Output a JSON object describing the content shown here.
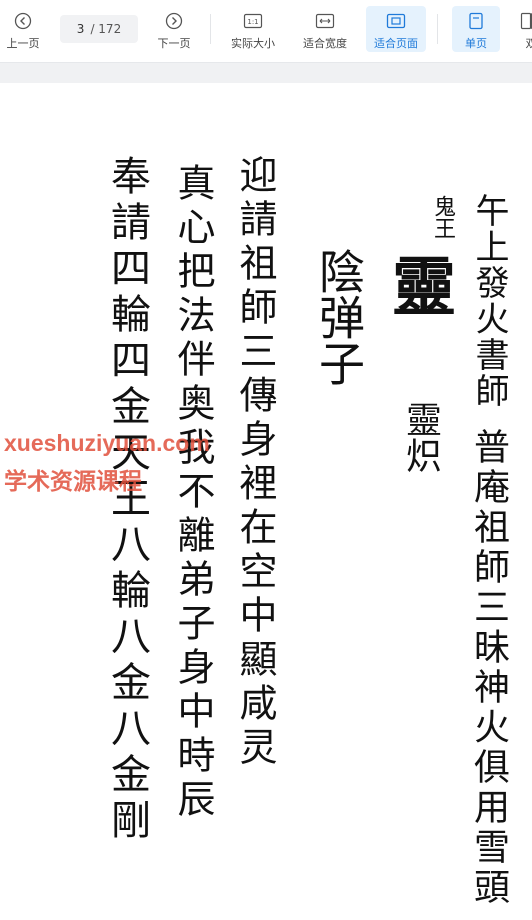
{
  "toolbar": {
    "prev_label": "上一页",
    "current_page": "3",
    "total_pages": "/ 172",
    "next_label": "下一页",
    "actual_size_label": "实际大小",
    "fit_width_label": "适合宽度",
    "fit_page_label": "适合页面",
    "single_page_label": "单页",
    "double_page_label": "双",
    "active_view": "适合页面",
    "active_layout": "单页"
  },
  "document": {
    "columns": [
      "午上發火書師",
      "鬼王",
      "靈",
      "靈炽",
      "普庵祖師三昧神火俱用雪頭",
      "陰弹子",
      "迎請祖師三傳身裡在空中顯咸灵",
      "真心把法伴奥我不離弟子身中時辰",
      "奉請四輪四金天王八輪八金八金剛"
    ]
  },
  "watermark": {
    "line1": "xueshuziyuan.com",
    "line2": "学术资源课程"
  },
  "colors": {
    "accent": "#1f7ad9",
    "active_bg": "#e5f2fd",
    "watermark": "#e0503c",
    "ink": "#111111"
  }
}
